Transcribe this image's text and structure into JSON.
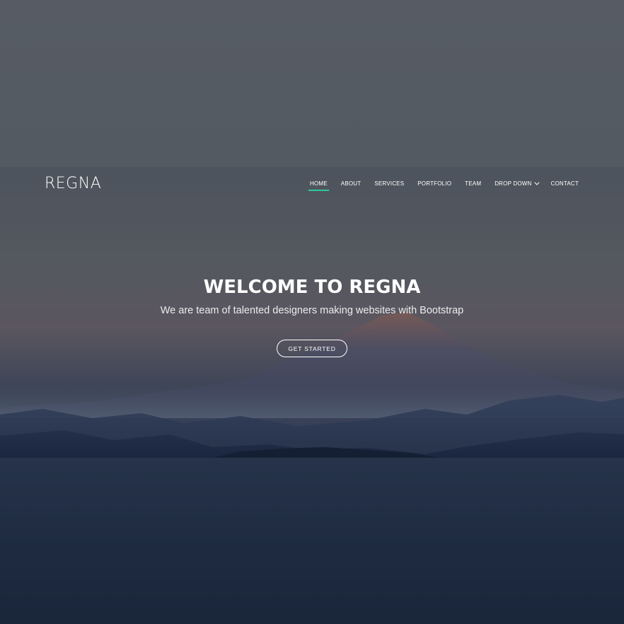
{
  "brand": {
    "logo_text": "REGNA"
  },
  "nav": {
    "items": [
      {
        "label": "HOME",
        "active": true
      },
      {
        "label": "ABOUT"
      },
      {
        "label": "SERVICES"
      },
      {
        "label": "PORTFOLIO"
      },
      {
        "label": "TEAM"
      },
      {
        "label": "DROP DOWN",
        "icon": "chevron-down-icon"
      },
      {
        "label": "CONTACT"
      }
    ]
  },
  "hero": {
    "title": "WELCOME TO REGNA",
    "subtitle": "We are team of talented designers making websites with Bootstrap",
    "cta_label": "GET STARTED"
  },
  "colors": {
    "accent": "#2dc997",
    "text": "#ffffff",
    "background_top": "#555b63",
    "background_bottom": "#1a2539"
  }
}
